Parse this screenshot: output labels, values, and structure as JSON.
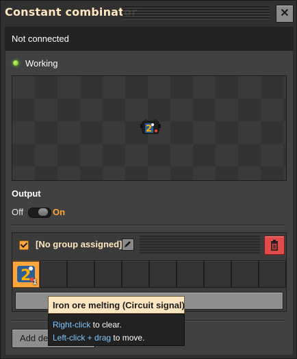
{
  "window": {
    "title": "Constant combinator",
    "close_glyph": "✕"
  },
  "status": {
    "connection_text": "Not connected",
    "working_text": "Working"
  },
  "output": {
    "label": "Output",
    "off_label": "Off",
    "on_label": "On",
    "state": "on"
  },
  "group": {
    "checked": true,
    "name": "[No group assigned]",
    "slots": [
      {
        "filled": true,
        "icon": "iron-ore-melting-icon",
        "count": "1"
      },
      {
        "filled": false
      },
      {
        "filled": false
      },
      {
        "filled": false
      },
      {
        "filled": false
      },
      {
        "filled": false
      },
      {
        "filled": false
      },
      {
        "filled": false
      },
      {
        "filled": false
      },
      {
        "filled": false
      }
    ]
  },
  "add_section": {
    "label": "Add de"
  },
  "tooltip": {
    "title": "Iron ore melting (Circuit signal)",
    "line1_key": "Right-click",
    "line1_text": " to clear.",
    "line2_key": "Left-click + drag",
    "line2_text": " to move."
  },
  "colors": {
    "accent_orange": "#ffa53c",
    "title_cream": "#ffe6c0",
    "delete_red": "#e04b4b",
    "status_green": "#7bd12f",
    "key_blue": "#80c8ff"
  }
}
